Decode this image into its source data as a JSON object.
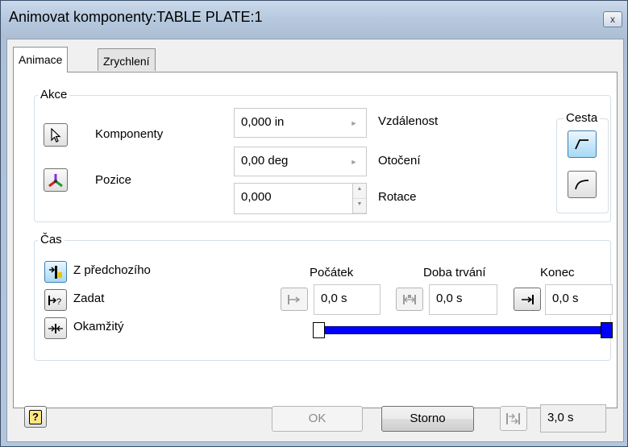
{
  "window": {
    "title": "Animovat komponenty:TABLE PLATE:1",
    "close_glyph": "x"
  },
  "tabs": [
    {
      "label": "Animace",
      "active": true
    },
    {
      "label": "Zrychlení",
      "active": false
    }
  ],
  "akce": {
    "label": "Akce",
    "components_label": "Komponenty",
    "position_label": "Pozice",
    "fields": {
      "distance": {
        "value": "0,000 in",
        "label": "Vzdálenost"
      },
      "rotation_angle": {
        "value": "0,00 deg",
        "label": "Otočení"
      },
      "rotations": {
        "value": "0,000",
        "label": "Rotace"
      }
    },
    "path": {
      "label": "Cesta"
    }
  },
  "cas": {
    "label": "Čas",
    "options": [
      {
        "label": "Z předchozího",
        "icon": "from-previous-icon"
      },
      {
        "label": "Zadat",
        "icon": "specify-icon"
      },
      {
        "label": "Okamžitý",
        "icon": "instantaneous-icon"
      }
    ],
    "start": {
      "label": "Počátek",
      "value": "0,0 s"
    },
    "duration": {
      "label": "Doba trvání",
      "value": "0,0 s"
    },
    "end": {
      "label": "Konec",
      "value": "0,0 s"
    },
    "timeline": {
      "start_fraction": 0.0,
      "end_fraction": 1.0
    }
  },
  "footer": {
    "help_glyph": "?",
    "ok_label": "OK",
    "cancel_label": "Storno",
    "total_time": "3,0 s"
  },
  "colors": {
    "timeline_bar": "#0000ff",
    "selected_button": "#a7d9f5",
    "title_bar": "#b6c9df"
  }
}
